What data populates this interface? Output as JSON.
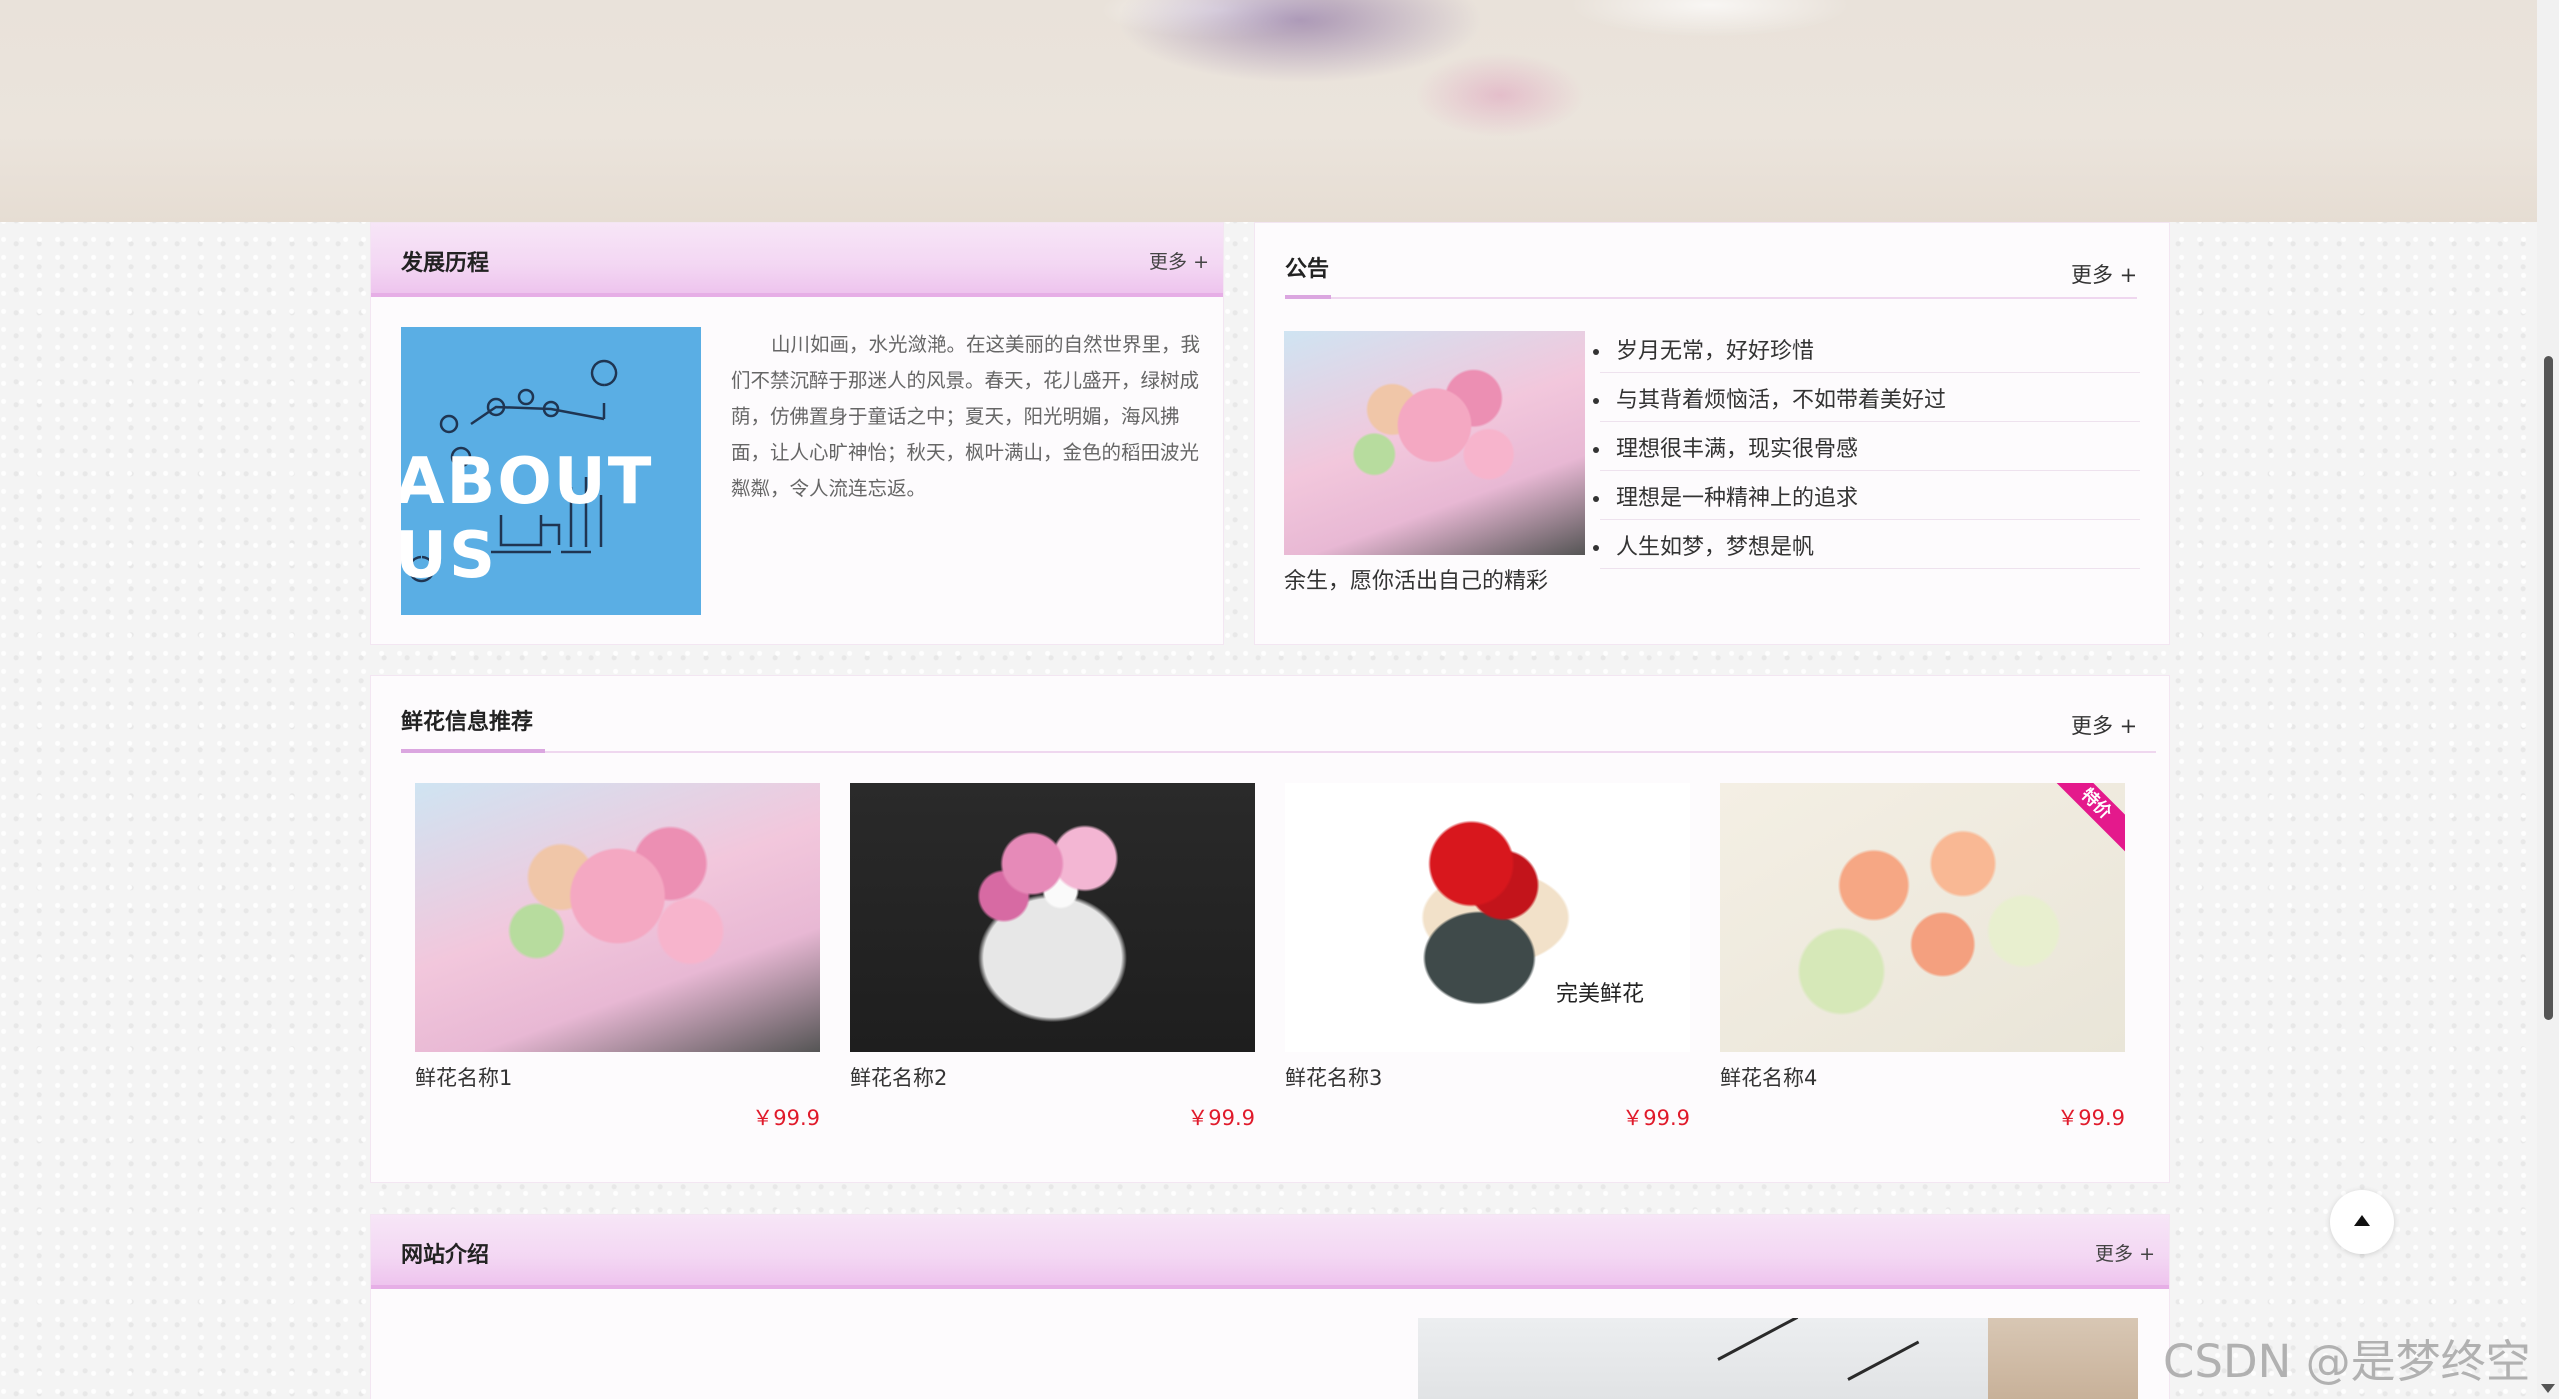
{
  "history": {
    "title": "发展历程",
    "more": "更多 +",
    "image_text": "ABOUT US",
    "text": "山川如画，水光潋滟。在这美丽的自然世界里，我们不禁沉醉于那迷人的风景。春天，花儿盛开，绿树成荫，仿佛置身于童话之中；夏天，阳光明媚，海风拂面，让人心旷神怡；秋天，枫叶满山，金色的稻田波光粼粼，令人流连忘返。"
  },
  "notice": {
    "title": "公告",
    "more": "更多 +",
    "items": [
      "岁月无常，好好珍惜",
      "与其背着烦恼活，不如带着美好过",
      "理想很丰满，现实很骨感",
      "理想是一种精神上的追求",
      "人生如梦，梦想是帆"
    ],
    "caption": "余生，愿你活出自己的精彩"
  },
  "recommend": {
    "title": "鲜花信息推荐",
    "more": "更多 +",
    "items": [
      {
        "name": "鲜花名称1",
        "price": "￥99.9"
      },
      {
        "name": "鲜花名称2",
        "price": "￥99.9"
      },
      {
        "name": "鲜花名称3",
        "price": "￥99.9",
        "overlay": "完美鲜花"
      },
      {
        "name": "鲜花名称4",
        "price": "￥99.9",
        "badge": "特价"
      }
    ]
  },
  "intro": {
    "title": "网站介绍",
    "more": "更多 +"
  },
  "watermark": "CSDN @是梦终空"
}
